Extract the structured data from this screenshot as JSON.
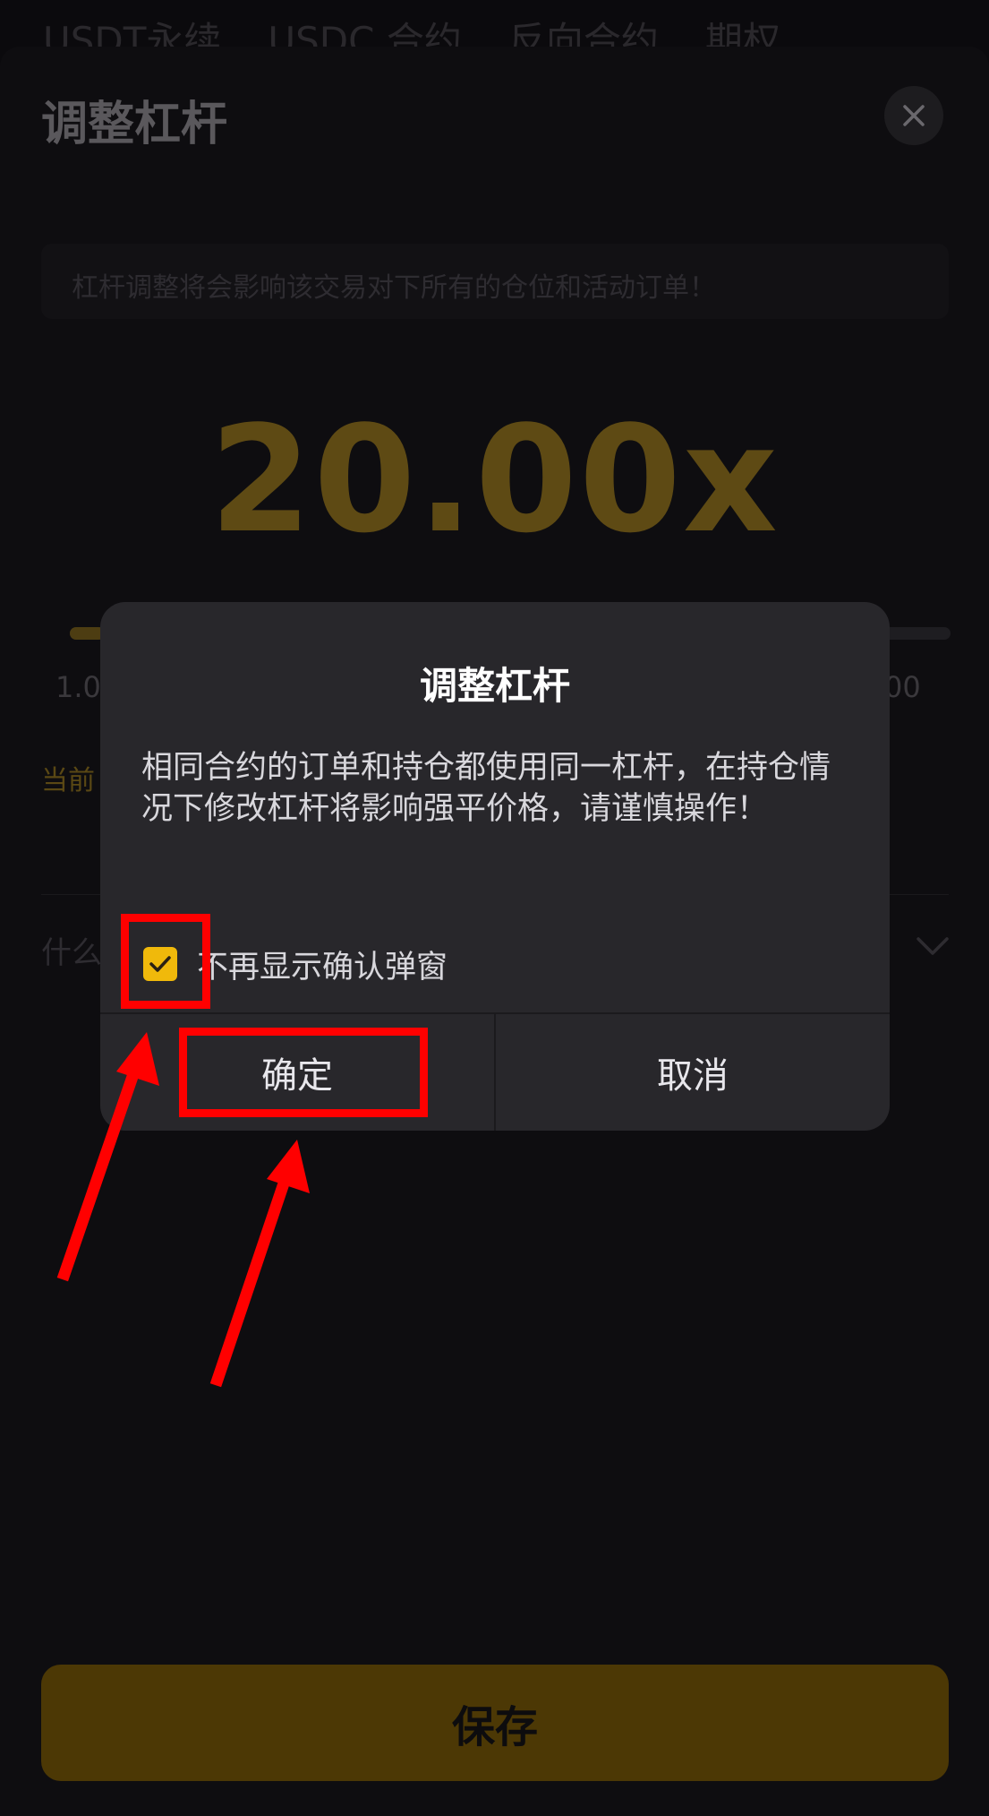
{
  "top_tabs": [
    "USDT永续",
    "USDC 合约",
    "反向合约",
    "期权"
  ],
  "sheet": {
    "title": "调整杠杆",
    "notice": "杠杆调整将会影响该交易对下所有的仓位和活动订单！",
    "leverage_display": "20.00x",
    "leverage_fraction": 0.04,
    "slider_min_label": "1.0",
    "slider_max_label": "00",
    "current_label": "当前",
    "faq_label": "什么",
    "save_label": "保存"
  },
  "dialog": {
    "title": "调整杠杆",
    "body": "相同合约的订单和持仓都使用同一杠杆，在持仓情况下修改杠杆将影响强平价格，请谨慎操作！",
    "dont_show_label": "不再显示确认弹窗",
    "dont_show_checked": true,
    "confirm_label": "确定",
    "cancel_label": "取消"
  },
  "colors": {
    "accent": "#f0b90b",
    "annotation": "#ff0000",
    "dialog_bg": "#28272b"
  }
}
